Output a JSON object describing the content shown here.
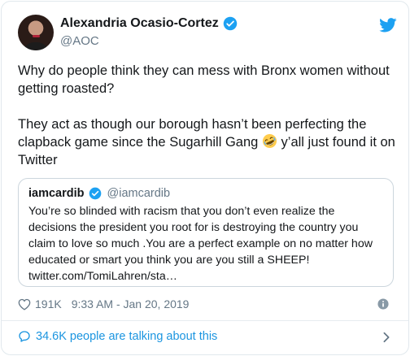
{
  "author": {
    "display_name": "Alexandria Ocasio-Cortez",
    "handle": "@AOC"
  },
  "icons": {
    "verified": "verified-badge-icon",
    "brand": "twitter-bird-icon",
    "emoji": "rolling-on-floor-laughing-emoji-icon",
    "like": "heart-icon",
    "info": "info-icon",
    "replies": "speech-bubble-icon",
    "chevron": "chevron-right-icon"
  },
  "colors": {
    "brand": "#1da1f2",
    "text": "#14171a",
    "secondary": "#657786",
    "link": "#1b95e0"
  },
  "tweet": {
    "line1": "Why do people think they can mess with Bronx women without getting roasted?",
    "line2_before_emoji": "They act as though our borough hasn’t been perfecting the clapback game since the Sugarhill Gang ",
    "line2_after_emoji": " y’all just found it on Twitter"
  },
  "quoted": {
    "display_name": "iamcardib",
    "handle": "@iamcardib",
    "text": "You’re so blinded with racism that you don’t even realize the decisions the president you root for is destroying the country you claim to love so much .You are a perfect example on no matter how educated or smart you think you are you still a SHEEP! twitter.com/TomiLahren/sta…"
  },
  "meta": {
    "likes": "191K",
    "timestamp": "9:33 AM - Jan 20, 2019"
  },
  "footer": {
    "conversation": "34.6K people are talking about this"
  }
}
